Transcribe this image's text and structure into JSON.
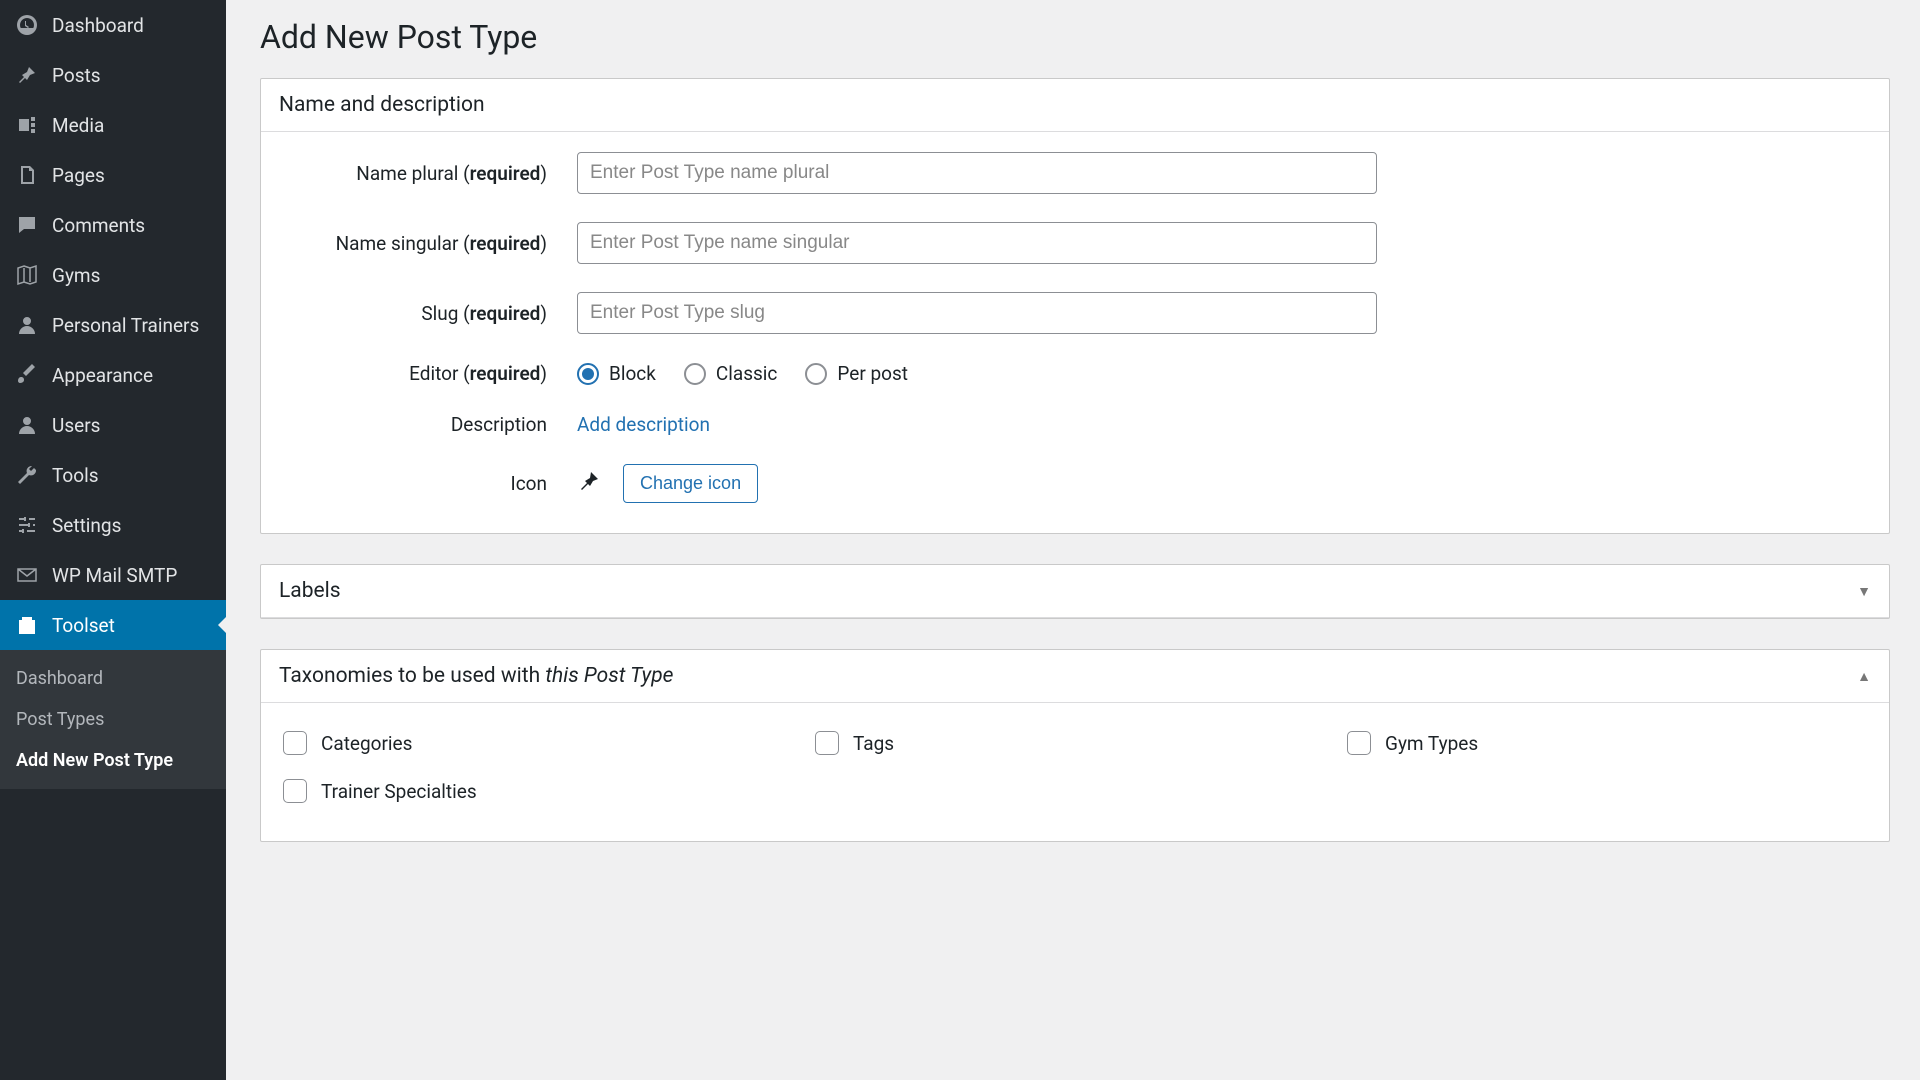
{
  "page": {
    "title": "Add New Post Type"
  },
  "sidebar": {
    "items": [
      {
        "label": "Dashboard",
        "icon": "dashboard"
      },
      {
        "label": "Posts",
        "icon": "pin"
      },
      {
        "label": "Media",
        "icon": "media"
      },
      {
        "label": "Pages",
        "icon": "pages"
      },
      {
        "label": "Comments",
        "icon": "comment"
      },
      {
        "label": "Gyms",
        "icon": "map"
      },
      {
        "label": "Personal Trainers",
        "icon": "user"
      },
      {
        "label": "Appearance",
        "icon": "brush"
      },
      {
        "label": "Users",
        "icon": "user"
      },
      {
        "label": "Tools",
        "icon": "wrench"
      },
      {
        "label": "Settings",
        "icon": "sliders"
      },
      {
        "label": "WP Mail SMTP",
        "icon": "mail"
      },
      {
        "label": "Toolset",
        "icon": "toolset",
        "active": true
      }
    ],
    "submenu": [
      {
        "label": "Dashboard"
      },
      {
        "label": "Post Types"
      },
      {
        "label": "Add New Post Type",
        "current": true
      }
    ]
  },
  "panels": {
    "name_description": {
      "title": "Name and description",
      "fields": {
        "name_plural": {
          "label_prefix": "Name plural (",
          "req": "required",
          "label_suffix": ")",
          "placeholder": "Enter Post Type name plural",
          "value": ""
        },
        "name_singular": {
          "label_prefix": "Name singular (",
          "req": "required",
          "label_suffix": ")",
          "placeholder": "Enter Post Type name singular",
          "value": ""
        },
        "slug": {
          "label_prefix": "Slug (",
          "req": "required",
          "label_suffix": ")",
          "placeholder": "Enter Post Type slug",
          "value": ""
        },
        "editor": {
          "label_prefix": "Editor (",
          "req": "required",
          "label_suffix": ")",
          "options": [
            {
              "label": "Block",
              "checked": true
            },
            {
              "label": "Classic",
              "checked": false
            },
            {
              "label": "Per post",
              "checked": false
            }
          ]
        },
        "description": {
          "label": "Description",
          "link": "Add description"
        },
        "icon": {
          "label": "Icon",
          "button": "Change icon"
        }
      }
    },
    "labels": {
      "title": "Labels"
    },
    "taxonomies": {
      "title_prefix": "Taxonomies to be used with ",
      "title_italic": "this Post Type",
      "options": [
        {
          "label": "Categories"
        },
        {
          "label": "Tags"
        },
        {
          "label": "Gym Types"
        },
        {
          "label": "Trainer Specialties"
        }
      ]
    }
  }
}
